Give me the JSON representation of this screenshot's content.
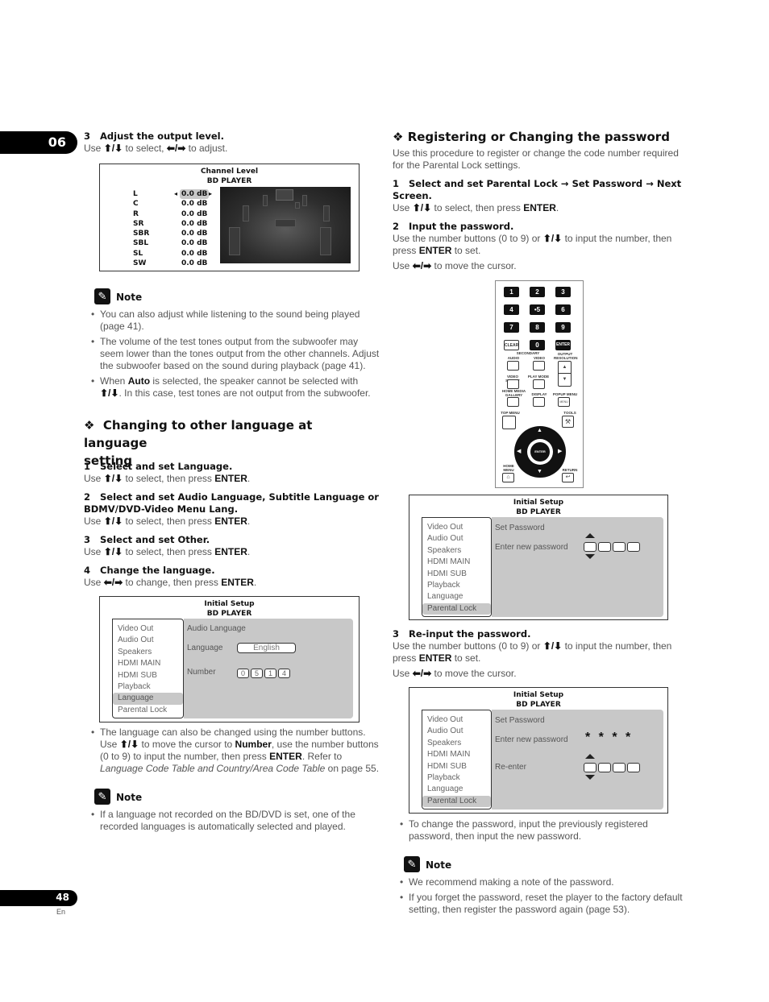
{
  "chapter": "06",
  "page": {
    "number": "48",
    "lang": "En"
  },
  "left": {
    "step3": {
      "num": "3",
      "title": "Adjust the output level.",
      "instr_pre": "Use",
      "instr_mid": "to select,",
      "instr_post": "to adjust."
    },
    "channel_screen": {
      "title": "Channel Level",
      "subtitle": "BD PLAYER",
      "channels": [
        {
          "name": "L",
          "value": "0.0 dB",
          "selected": true
        },
        {
          "name": "C",
          "value": "0.0 dB"
        },
        {
          "name": "R",
          "value": "0.0 dB"
        },
        {
          "name": "SR",
          "value": "0.0 dB"
        },
        {
          "name": "SBR",
          "value": "0.0 dB"
        },
        {
          "name": "SBL",
          "value": "0.0 dB"
        },
        {
          "name": "SL",
          "value": "0.0 dB"
        },
        {
          "name": "SW",
          "value": "0.0 dB"
        }
      ]
    },
    "note1": {
      "label": "Note",
      "b1": "You can also adjust while listening to the sound being played (page 41).",
      "b2": "The volume of the test tones output from the subwoofer may seem lower than the tones output from the other channels. Adjust the subwoofer based on the sound during playback (page 41).",
      "b3_pre": "When",
      "b3_bold": "Auto",
      "b3_mid": "is selected, the speaker cannot be selected with",
      "b3_post": ". In this case, test tones are not output from the subwoofer."
    },
    "lang_section": {
      "title_line1": "Changing to other language at language",
      "title_line2": "setting",
      "steps": [
        {
          "num": "1",
          "title": "Select and set Language.",
          "instr": "to select, then press"
        },
        {
          "num": "2",
          "title": "Select and set Audio Language, Subtitle Language or",
          "title2": "BDMV/DVD-Video Menu Lang.",
          "instr": "to select, then press"
        },
        {
          "num": "3",
          "title": "Select and set Other.",
          "instr": "to select, then press"
        },
        {
          "num": "4",
          "title": "Change the language.",
          "instr": "to change, then press"
        }
      ],
      "use": "Use",
      "enter": "ENTER"
    },
    "lang_screen": {
      "title": "Initial Setup",
      "subtitle": "BD PLAYER",
      "menu": [
        "Video Out",
        "Audio Out",
        "Speakers",
        "HDMI MAIN",
        "HDMI SUB",
        "Playback",
        "Language",
        "Parental Lock"
      ],
      "selected_index": 6,
      "panel_heading": "Audio Language",
      "language_label": "Language",
      "language_value": "English",
      "number_label": "Number",
      "number_digits": [
        "0",
        "5",
        "1",
        "4"
      ]
    },
    "bullet_lang": {
      "p1": "The language can also be changed using the number buttons. Use",
      "p2": "to move the cursor to",
      "bold1": "Number",
      "p3": ", use the number buttons (0 to 9) to input the number, then press",
      "bold2": "ENTER",
      "p4": ". Refer to",
      "italic": "Language Code Table and Country/Area Code Table",
      "p5": "on page 55."
    },
    "note2": {
      "label": "Note",
      "b1": "If a language not recorded on the BD/DVD is set, one of the recorded languages is automatically selected and played."
    }
  },
  "right": {
    "section_title": "Registering or Changing the password",
    "intro": "Use this procedure to register or change the code number required for the Parental Lock settings.",
    "step1": {
      "num": "1",
      "title_a": "Select and set Parental Lock",
      "title_b": "Set Password",
      "title_c": "Next",
      "title_d": "Screen.",
      "instr": "to select, then press"
    },
    "step2": {
      "num": "2",
      "title": "Input the password.",
      "instr_a": "Use the number buttons (0 to 9) or",
      "instr_b": "to input the number, then press",
      "instr_c": "to set.",
      "cursor_a": "Use",
      "cursor_b": "to move the cursor."
    },
    "remote": {
      "keys": [
        "1",
        "2",
        "3",
        "4",
        "•5",
        "6",
        "7",
        "8",
        "9",
        "CLEAR",
        "0",
        "ENTER"
      ],
      "labels": {
        "secondary": "SECONDARY",
        "audio": "AUDIO",
        "video": "VIDEO",
        "output_resolution": "OUTPUT RESOLUTION",
        "video_select": "VIDEO SELECT",
        "play_mode": "PLAY MODE",
        "home_media_gallery": "HOME MEDIA GALLERY",
        "display": "DISPLAY",
        "popup_menu": "POPUP MENU",
        "menu": "MENU",
        "top_menu": "TOP MENU",
        "tools": "TOOLS",
        "enter": "ENTER",
        "home_menu": "HOME MENU",
        "return": "RETURN"
      }
    },
    "pw_screen1": {
      "title": "Initial Setup",
      "subtitle": "BD PLAYER",
      "menu": [
        "Video Out",
        "Audio Out",
        "Speakers",
        "HDMI MAIN",
        "HDMI SUB",
        "Playback",
        "Language",
        "Parental Lock"
      ],
      "selected_index": 7,
      "heading": "Set Password",
      "enter_label": "Enter new password"
    },
    "step3": {
      "num": "3",
      "title": "Re-input the password.",
      "instr_a": "Use the number buttons (0 to 9) or",
      "instr_b": "to input the number, then press",
      "instr_c": "to set.",
      "cursor_a": "Use",
      "cursor_b": "to move the cursor."
    },
    "pw_screen2": {
      "title": "Initial Setup",
      "subtitle": "BD PLAYER",
      "menu": [
        "Video Out",
        "Audio Out",
        "Speakers",
        "HDMI MAIN",
        "HDMI SUB",
        "Playback",
        "Language",
        "Parental Lock"
      ],
      "selected_index": 7,
      "heading": "Set Password",
      "enter_label": "Enter new password",
      "masked": "* * * *",
      "reenter_label": "Re-enter"
    },
    "bullet_change": "To change the password, input the previously registered password, then input the new password.",
    "note": {
      "label": "Note",
      "b1": "We recommend making a note of the password.",
      "b2": "If you forget the password, reset the player to the factory default setting, then register the password again (page 53)."
    },
    "enter": "ENTER",
    "use": "Use"
  },
  "glyphs": {
    "updown": "⬆/⬇",
    "leftright": "⬅/➡",
    "arrow_right": "→",
    "diamond": "❖",
    "pencil": "✎"
  }
}
